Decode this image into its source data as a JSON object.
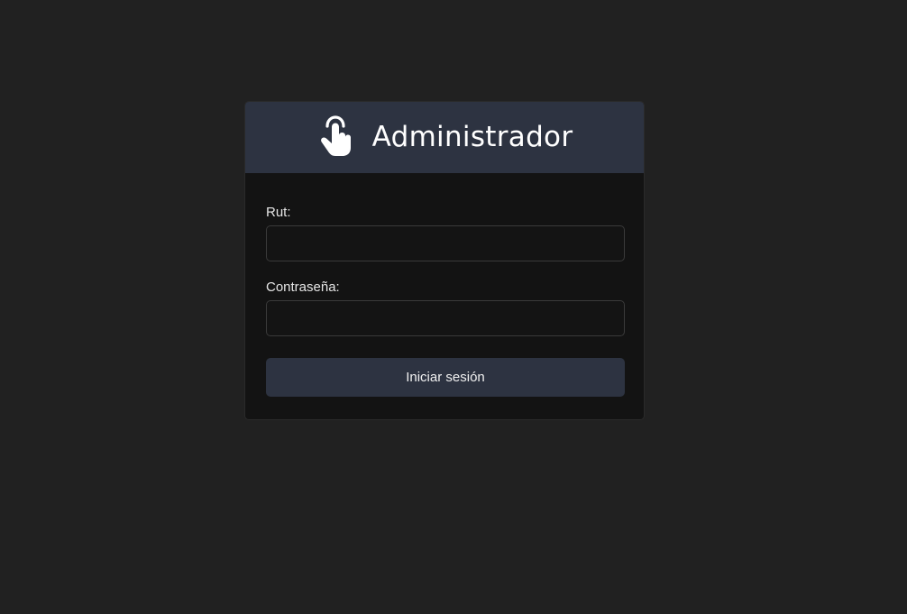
{
  "header": {
    "title": "Administrador",
    "icon": "pointer-hand-icon"
  },
  "form": {
    "rut_label": "Rut:",
    "rut_value": "",
    "password_label": "Contraseña:",
    "password_value": "",
    "submit_label": "Iniciar sesión"
  },
  "colors": {
    "page_background": "#212121",
    "card_background": "#131313",
    "header_background": "#2d3341",
    "button_background": "#2d3341",
    "text": "#ffffff"
  }
}
